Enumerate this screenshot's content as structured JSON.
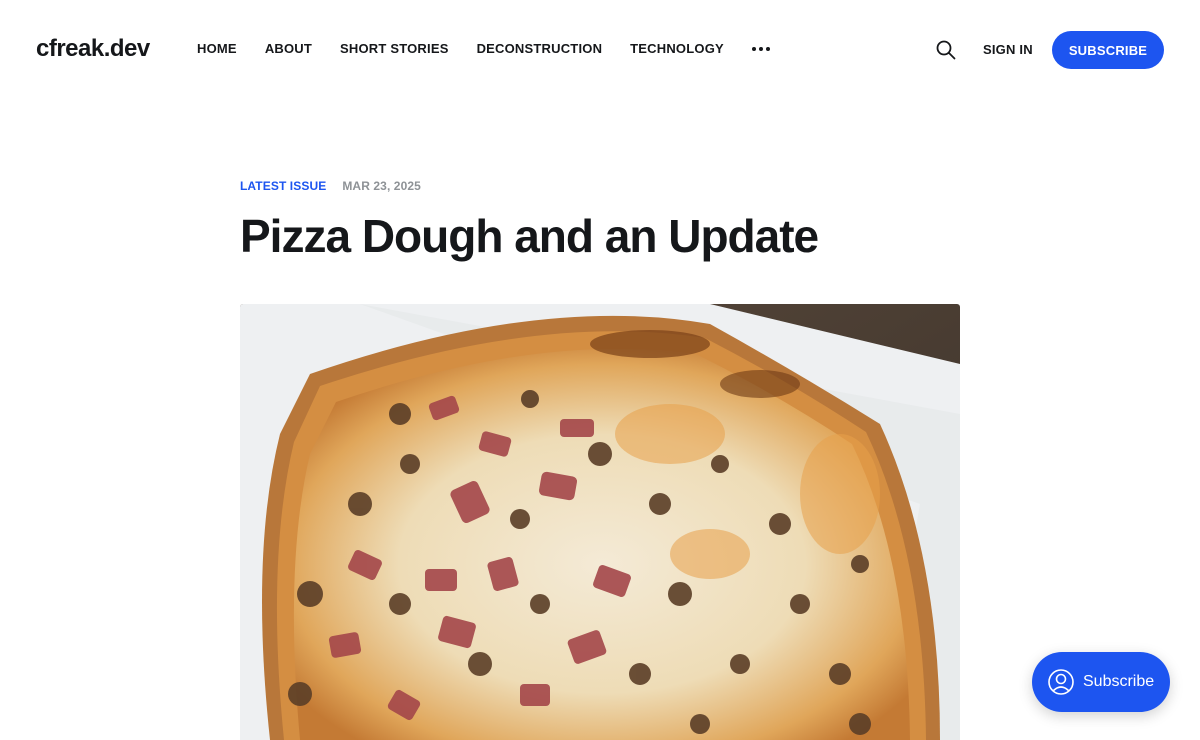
{
  "site": {
    "logo": "cfreak.dev"
  },
  "nav": {
    "items": [
      {
        "label": "HOME"
      },
      {
        "label": "ABOUT"
      },
      {
        "label": "SHORT STORIES"
      },
      {
        "label": "DECONSTRUCTION"
      },
      {
        "label": "TECHNOLOGY"
      }
    ],
    "more_icon": "more-horizontal-icon"
  },
  "header_actions": {
    "search_icon": "search-icon",
    "signin_label": "SIGN IN",
    "subscribe_label": "SUBSCRIBE"
  },
  "article": {
    "tag": "LATEST ISSUE",
    "date": "MAR 23, 2025",
    "title": "Pizza Dough and an Update",
    "feature_image": "pizza-photo"
  },
  "portal": {
    "label": "Subscribe",
    "icon": "user-circle-icon"
  },
  "colors": {
    "accent": "#1d55f0",
    "text": "#15171a",
    "muted": "#8e9296"
  }
}
